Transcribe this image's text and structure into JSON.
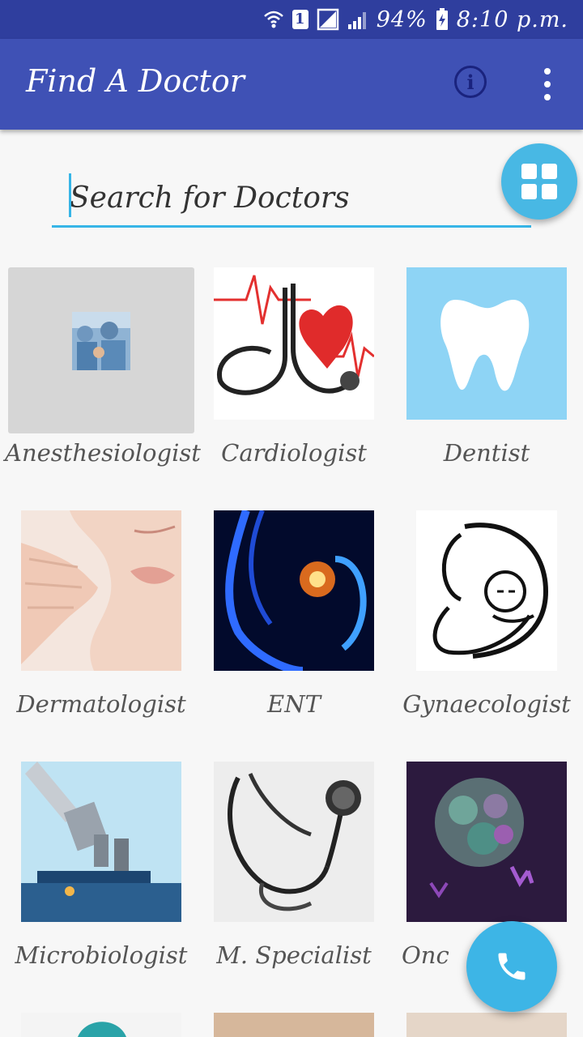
{
  "status_bar": {
    "sim_slot": "1",
    "battery": "94%",
    "time": "8:10 p.m."
  },
  "app_bar": {
    "title": "Find A Doctor",
    "info_icon": "info-circle-icon",
    "menu_icon": "overflow-menu-icon"
  },
  "search": {
    "placeholder": "Search for Doctors",
    "value": ""
  },
  "grid_toggle_icon": "grid-view-icon",
  "call_icon": "phone-icon",
  "categories": [
    {
      "label": "Anesthesiologist"
    },
    {
      "label": "Cardiologist"
    },
    {
      "label": "Dentist"
    },
    {
      "label": "Dermatologist"
    },
    {
      "label": "ENT"
    },
    {
      "label": "Gynaecologist"
    },
    {
      "label": "Microbiologist"
    },
    {
      "label": "M. Specialist"
    },
    {
      "label": "Onc"
    }
  ],
  "colors": {
    "status_bar": "#2f3e9e",
    "app_bar": "#3f51b5",
    "accent": "#36b5e7",
    "background": "#f7f7f7"
  }
}
